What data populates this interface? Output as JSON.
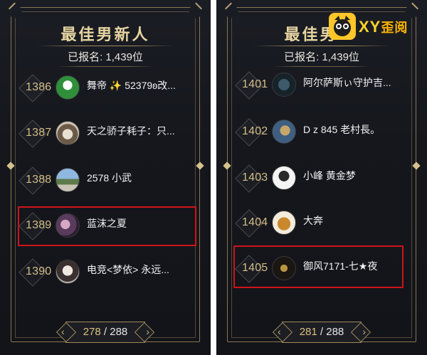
{
  "panels": [
    {
      "title": "最佳男新人",
      "registered": "已报名: 1,439位",
      "rows": [
        {
          "rank": "1386",
          "name": "舞帝 ✨ 52379ʚ改..."
        },
        {
          "rank": "1387",
          "name": "天之骄子耗子：只..."
        },
        {
          "rank": "1388",
          "name": "2578 小武"
        },
        {
          "rank": "1389",
          "name": "蓝沫之夏"
        },
        {
          "rank": "1390",
          "name": "电竞<梦依> 永远..."
        }
      ],
      "pager": {
        "current": "278",
        "separator": " / ",
        "total": "288"
      }
    },
    {
      "title": "最佳男",
      "registered": "已报名: 1,439位",
      "rows": [
        {
          "rank": "1401",
          "name": "阿尔萨斯ぃ守护吉..."
        },
        {
          "rank": "1402",
          "name": "D z 845 老村長。"
        },
        {
          "rank": "1403",
          "name": "小峰 黄金梦"
        },
        {
          "rank": "1404",
          "name": "大奔"
        },
        {
          "rank": "1405",
          "name": "御风7171-七★夜"
        }
      ],
      "pager": {
        "current": "281",
        "separator": " / ",
        "total": "288"
      }
    }
  ],
  "watermark": {
    "latin": "XY",
    "chinese": "歪阅"
  },
  "colors": {
    "gold": "#d4bd86",
    "highlight": "#d0131a",
    "panel_bg": "#15171d"
  }
}
